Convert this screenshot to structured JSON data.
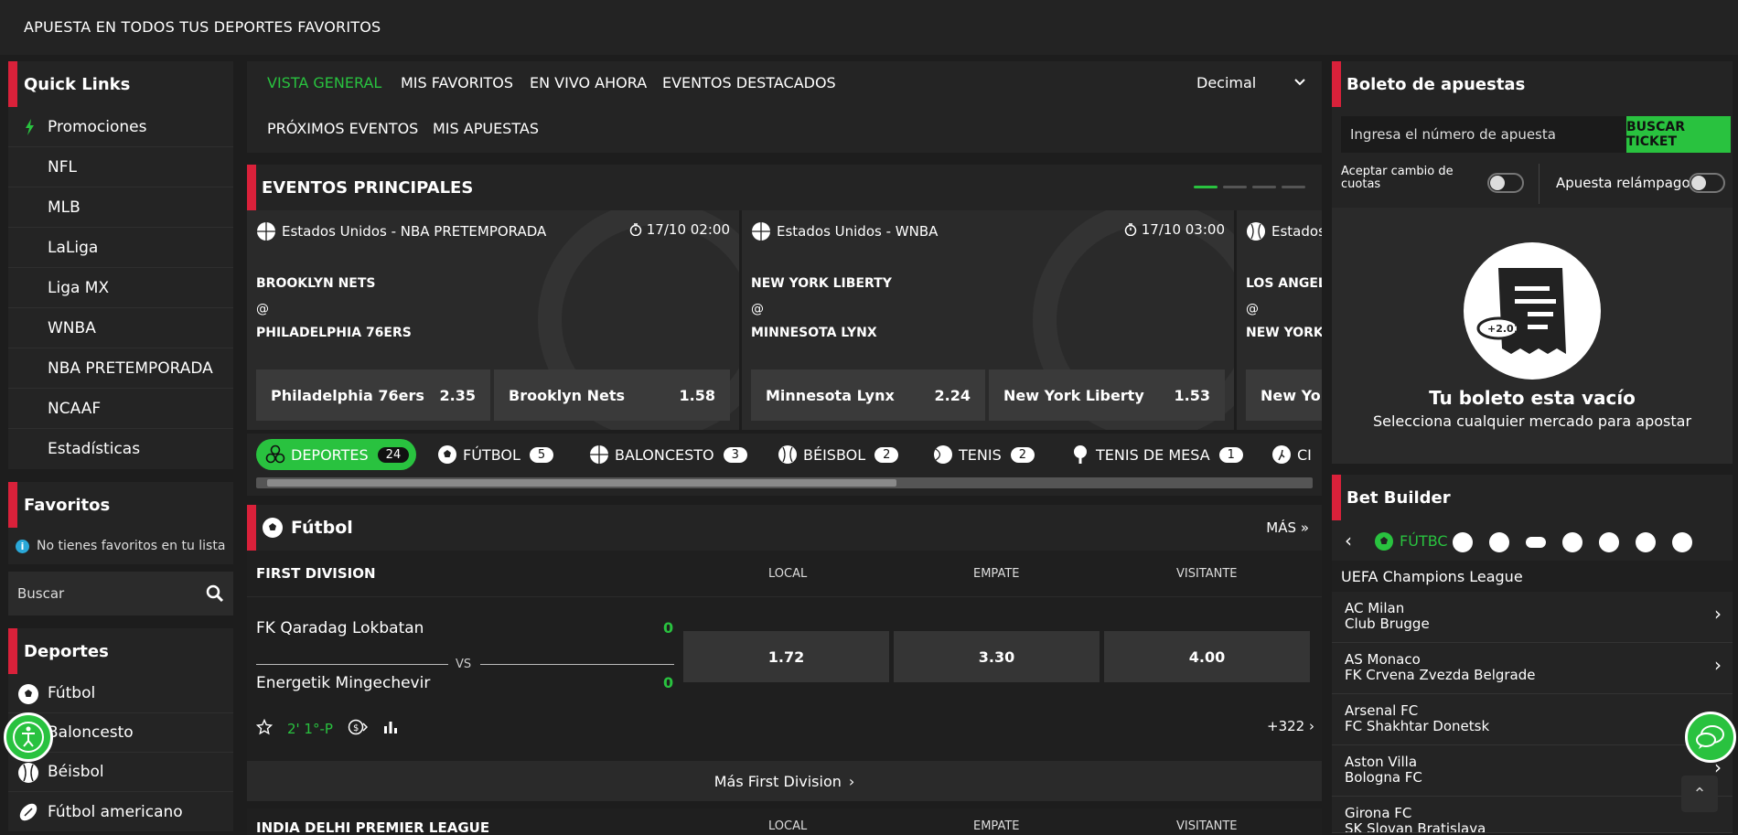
{
  "topbar": {
    "title": "APUESTA EN TODOS TUS DEPORTES FAVORITOS"
  },
  "quick_links": {
    "title": "Quick Links",
    "items": [
      "Promociones",
      "NFL",
      "MLB",
      "LaLiga",
      "Liga MX",
      "WNBA",
      "NBA PRETEMPORADA",
      "NCAAF",
      "Estadísticas"
    ]
  },
  "favorites": {
    "title": "Favoritos",
    "empty": "No tienes favoritos en tu lista"
  },
  "search": {
    "placeholder": "Buscar"
  },
  "sports": {
    "title": "Deportes",
    "items": [
      "Fútbol",
      "Baloncesto",
      "Béisbol",
      "Fútbol americano"
    ]
  },
  "nav": {
    "tabs": [
      "VISTA GENERAL",
      "MIS FAVORITOS",
      "EN VIVO AHORA",
      "EVENTOS DESTACADOS",
      "PRÓXIMOS EVENTOS",
      "MIS APUESTAS"
    ],
    "odds_format": "Decimal"
  },
  "featured": {
    "title": "EVENTOS PRINCIPALES",
    "events": [
      {
        "league": "Estados Unidos - NBA PRETEMPORADA",
        "time": "17/10 02:00",
        "home": "BROOKLYN NETS",
        "at": "@",
        "away": "PHILADELPHIA 76ERS",
        "odds": [
          {
            "team": "Philadelphia 76ers",
            "value": "2.35"
          },
          {
            "team": "Brooklyn Nets",
            "value": "1.58"
          }
        ]
      },
      {
        "league": "Estados Unidos - WNBA",
        "time": "17/10 03:00",
        "home": "NEW YORK LIBERTY",
        "at": "@",
        "away": "MINNESOTA LYNX",
        "odds": [
          {
            "team": "Minnesota Lynx",
            "value": "2.24"
          },
          {
            "team": "New York Liberty",
            "value": "1.53"
          }
        ]
      },
      {
        "league": "Estados",
        "time": "",
        "home": "LOS ANGEL",
        "at": "@",
        "away": "NEW YORK L",
        "odds": [
          {
            "team": "New York",
            "value": ""
          }
        ]
      }
    ]
  },
  "sport_tabs": [
    {
      "label": "DEPORTES",
      "count": "24"
    },
    {
      "label": "FÚTBOL",
      "count": "5"
    },
    {
      "label": "BALONCESTO",
      "count": "3"
    },
    {
      "label": "BÉISBOL",
      "count": "2"
    },
    {
      "label": "TENIS",
      "count": "2"
    },
    {
      "label": "TENIS DE MESA",
      "count": "1"
    },
    {
      "label": "CI",
      "count": ""
    }
  ],
  "futbol": {
    "title": "Fútbol",
    "more": "MÁS",
    "league": "FIRST DIVISION",
    "cols": [
      "LOCAL",
      "EMPATE",
      "VISITANTE"
    ],
    "match": {
      "home": "FK Qaradag Lokbatan",
      "away": "Energetik Mingechevir",
      "home_score": "0",
      "away_score": "0",
      "vs": "VS",
      "odds": [
        "1.72",
        "3.30",
        "4.00"
      ],
      "live": "2' 1°-P",
      "markets": "+322"
    },
    "more_league": "Más First Division",
    "league2": "INDIA DELHI PREMIER LEAGUE",
    "cols2": [
      "LOCAL",
      "EMPATE",
      "VISITANTE"
    ]
  },
  "slip": {
    "title": "Boleto de apuestas",
    "ticket_placeholder": "Ingresa el número de apuesta",
    "ticket_button": "BUSCAR TICKET",
    "accept_odds": "Aceptar cambio de cuotas",
    "quick_bet": "Apuesta relámpago",
    "empty_title": "Tu boleto esta vacío",
    "empty_sub": "Selecciona cualquier mercado para apostar",
    "illustration_odds": "+2.01"
  },
  "bet_builder": {
    "title": "Bet Builder",
    "sport": "FÚTBC",
    "competition": "UEFA Champions League",
    "matches": [
      {
        "home": "AC Milan",
        "away": "Club Brugge"
      },
      {
        "home": "AS Monaco",
        "away": "FK Crvena Zvezda Belgrade"
      },
      {
        "home": "Arsenal FC",
        "away": "FC Shakhtar Donetsk"
      },
      {
        "home": "Aston Villa",
        "away": "Bologna FC"
      },
      {
        "home": "Girona FC",
        "away": "SK Slovan Bratislava"
      }
    ]
  },
  "colors": {
    "accent": "#29c23f",
    "brand_red": "#d9213a",
    "bg": "#1d1d1d"
  }
}
